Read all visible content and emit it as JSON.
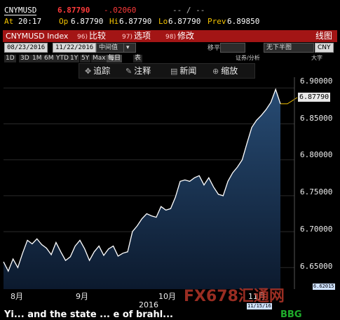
{
  "quote": {
    "ticker": "CNYMUSD",
    "last": "6.87790",
    "change": "-.02060",
    "bid_ask": "-- / --",
    "time_label": "At",
    "time": "20:17",
    "open_label": "Op",
    "open": "6.87790",
    "high_label": "Hi",
    "high": "6.87790",
    "low_label": "Lo",
    "low": "6.87790",
    "prev_label": "Prev",
    "prev": "6.89850"
  },
  "funcbar": {
    "security": "CNYMUSD Index",
    "compare_num": "96)",
    "compare": "比较",
    "options_num": "97)",
    "options": "选项",
    "edit_num": "98)",
    "edit": "修改",
    "chart_type": "线图"
  },
  "params": {
    "start_date": "08/23/2016",
    "end_date": "11/22/2016",
    "price_field": "中间值",
    "period": "日",
    "mode": "移平",
    "display_icon_label": "证券/分析",
    "currency_label": "无下半图",
    "currency": "CNY",
    "size_label": "大字"
  },
  "ranges": [
    "1D",
    "3D",
    "1M",
    "6M",
    "YTD",
    "1Y",
    "5Y",
    "Max",
    "每日",
    "表"
  ],
  "toolbar": {
    "track": "追踪",
    "annotate": "注释",
    "news": "新闻",
    "zoom": "缩放"
  },
  "axis": {
    "y_ticks": [
      "6.90000",
      "6.85000",
      "6.80000",
      "6.75000",
      "6.70000",
      "6.65000"
    ],
    "last_tag": "6.87790",
    "low_tag": "6.62015",
    "x_ticks": [
      "8月",
      "9月",
      "10月",
      "11月"
    ],
    "year": "2016",
    "cursor_date": "11/15/16"
  },
  "watermark": "FX678汇通网",
  "caption": "Yi... and the state ... e of brahl...",
  "caption_right": "BBG",
  "colors": {
    "line": "#ffffff",
    "fill_top": "#274b73",
    "fill_bottom": "#0c1a2e",
    "funcbar": "#a31515",
    "accent": "#f5c400"
  },
  "chart_data": {
    "type": "area",
    "title": "CNYMUSD Index",
    "xlabel": "",
    "ylabel": "",
    "ylim": [
      6.62,
      6.915
    ],
    "x_ticks": [
      "8月",
      "9月",
      "10月",
      "11月"
    ],
    "y_ticks": [
      6.9,
      6.85,
      6.8,
      6.75,
      6.7,
      6.65
    ],
    "series": [
      {
        "name": "CNYMUSD",
        "x": [
          "2016-08-23",
          "2016-08-24",
          "2016-08-25",
          "2016-08-26",
          "2016-08-29",
          "2016-08-30",
          "2016-08-31",
          "2016-09-01",
          "2016-09-02",
          "2016-09-05",
          "2016-09-06",
          "2016-09-07",
          "2016-09-08",
          "2016-09-09",
          "2016-09-12",
          "2016-09-13",
          "2016-09-14",
          "2016-09-19",
          "2016-09-20",
          "2016-09-21",
          "2016-09-22",
          "2016-09-23",
          "2016-09-26",
          "2016-09-27",
          "2016-09-28",
          "2016-09-29",
          "2016-09-30",
          "2016-10-10",
          "2016-10-11",
          "2016-10-12",
          "2016-10-13",
          "2016-10-14",
          "2016-10-17",
          "2016-10-18",
          "2016-10-19",
          "2016-10-20",
          "2016-10-21",
          "2016-10-24",
          "2016-10-25",
          "2016-10-26",
          "2016-10-27",
          "2016-10-28",
          "2016-10-31",
          "2016-11-01",
          "2016-11-02",
          "2016-11-03",
          "2016-11-04",
          "2016-11-07",
          "2016-11-08",
          "2016-11-09",
          "2016-11-10",
          "2016-11-11",
          "2016-11-14",
          "2016-11-15",
          "2016-11-16",
          "2016-11-17",
          "2016-11-18",
          "2016-11-21",
          "2016-11-22"
        ],
        "values": [
          6.658,
          6.645,
          6.662,
          6.65,
          6.67,
          6.688,
          6.683,
          6.69,
          6.682,
          6.677,
          6.668,
          6.685,
          6.672,
          6.66,
          6.665,
          6.68,
          6.688,
          6.676,
          6.66,
          6.672,
          6.68,
          6.667,
          6.676,
          6.68,
          6.666,
          6.67,
          6.672,
          6.7,
          6.708,
          6.718,
          6.725,
          6.722,
          6.72,
          6.735,
          6.73,
          6.732,
          6.748,
          6.77,
          6.772,
          6.77,
          6.775,
          6.778,
          6.765,
          6.775,
          6.762,
          6.752,
          6.75,
          6.77,
          6.782,
          6.79,
          6.8,
          6.823,
          6.845,
          6.855,
          6.862,
          6.87,
          6.88,
          6.898,
          6.878
        ]
      }
    ]
  }
}
